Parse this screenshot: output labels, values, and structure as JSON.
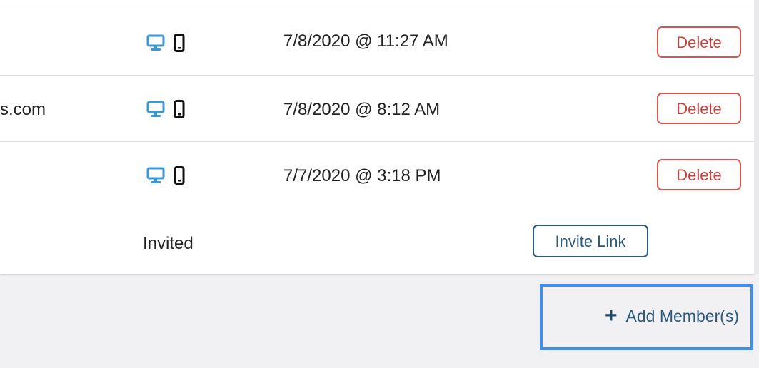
{
  "rows": [
    {
      "email": "",
      "date": "7/8/2020 @ 11:27 AM",
      "action_label": "Delete"
    },
    {
      "email": "s.com",
      "date": "7/8/2020 @ 8:12 AM",
      "action_label": "Delete"
    },
    {
      "email": "",
      "date": "7/7/2020 @ 3:18 PM",
      "action_label": "Delete"
    }
  ],
  "invited_row": {
    "status": "Invited",
    "action_label": "Invite Link"
  },
  "add_members": {
    "label": "Add Member(s)",
    "icon": "plus-icon"
  },
  "icons": {
    "desktop": "desktop-icon",
    "mobile": "mobile-icon"
  },
  "colors": {
    "delete": "#d9534f",
    "primary": "#2b5a7e",
    "desktop_icon": "#3a9ad9",
    "highlight": "#3f8ef0",
    "background": "#f1f1f3"
  }
}
